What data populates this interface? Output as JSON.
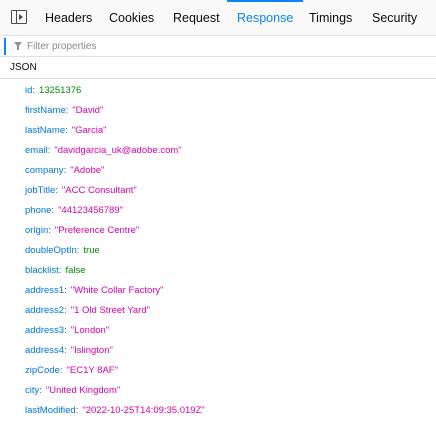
{
  "tabs": [
    {
      "label": "Headers"
    },
    {
      "label": "Cookies"
    },
    {
      "label": "Request"
    },
    {
      "label": "Response"
    },
    {
      "label": "Timings"
    },
    {
      "label": "Security"
    }
  ],
  "active_tab": "Response",
  "filter": {
    "placeholder": "Filter properties",
    "value": ""
  },
  "section_label": "JSON",
  "json_rows": [
    {
      "key": "id",
      "value": "13251376",
      "type": "num"
    },
    {
      "key": "firstName",
      "value": "\"David\"",
      "type": "str"
    },
    {
      "key": "lastName",
      "value": "\"Garcia\"",
      "type": "str"
    },
    {
      "key": "email",
      "value": "\"davidgarcia_uk@adobe.com\"",
      "type": "str"
    },
    {
      "key": "company",
      "value": "\"Adobe\"",
      "type": "str"
    },
    {
      "key": "jobTitle",
      "value": "\"ACC Consultant\"",
      "type": "str"
    },
    {
      "key": "phone",
      "value": "\"44123456789\"",
      "type": "str"
    },
    {
      "key": "origin",
      "value": "\"Preference Centre\"",
      "type": "str"
    },
    {
      "key": "doubleOptIn",
      "value": "true",
      "type": "bool"
    },
    {
      "key": "blacklist",
      "value": "false",
      "type": "bool"
    },
    {
      "key": "address1",
      "value": "\"White Collar Factory\"",
      "type": "str"
    },
    {
      "key": "address2",
      "value": "\"1 Old Street Yard\"",
      "type": "str"
    },
    {
      "key": "address3",
      "value": "\"London\"",
      "type": "str"
    },
    {
      "key": "address4",
      "value": "\"Islington\"",
      "type": "str"
    },
    {
      "key": "zipCode",
      "value": "\"EC1Y 8AF\"",
      "type": "str"
    },
    {
      "key": "city",
      "value": "\"United Kingdom\"",
      "type": "str"
    },
    {
      "key": "lastModified",
      "value": "\"2022-10-25T14:09:35.019Z\"",
      "type": "str"
    }
  ],
  "colors": {
    "accent": "#0a84ff",
    "key": "#0074e8",
    "string": "#dd00a9",
    "number_bool": "#058b00"
  },
  "icons": {
    "toggle": "sidebar-toggle-icon",
    "filter": "funnel-icon"
  }
}
